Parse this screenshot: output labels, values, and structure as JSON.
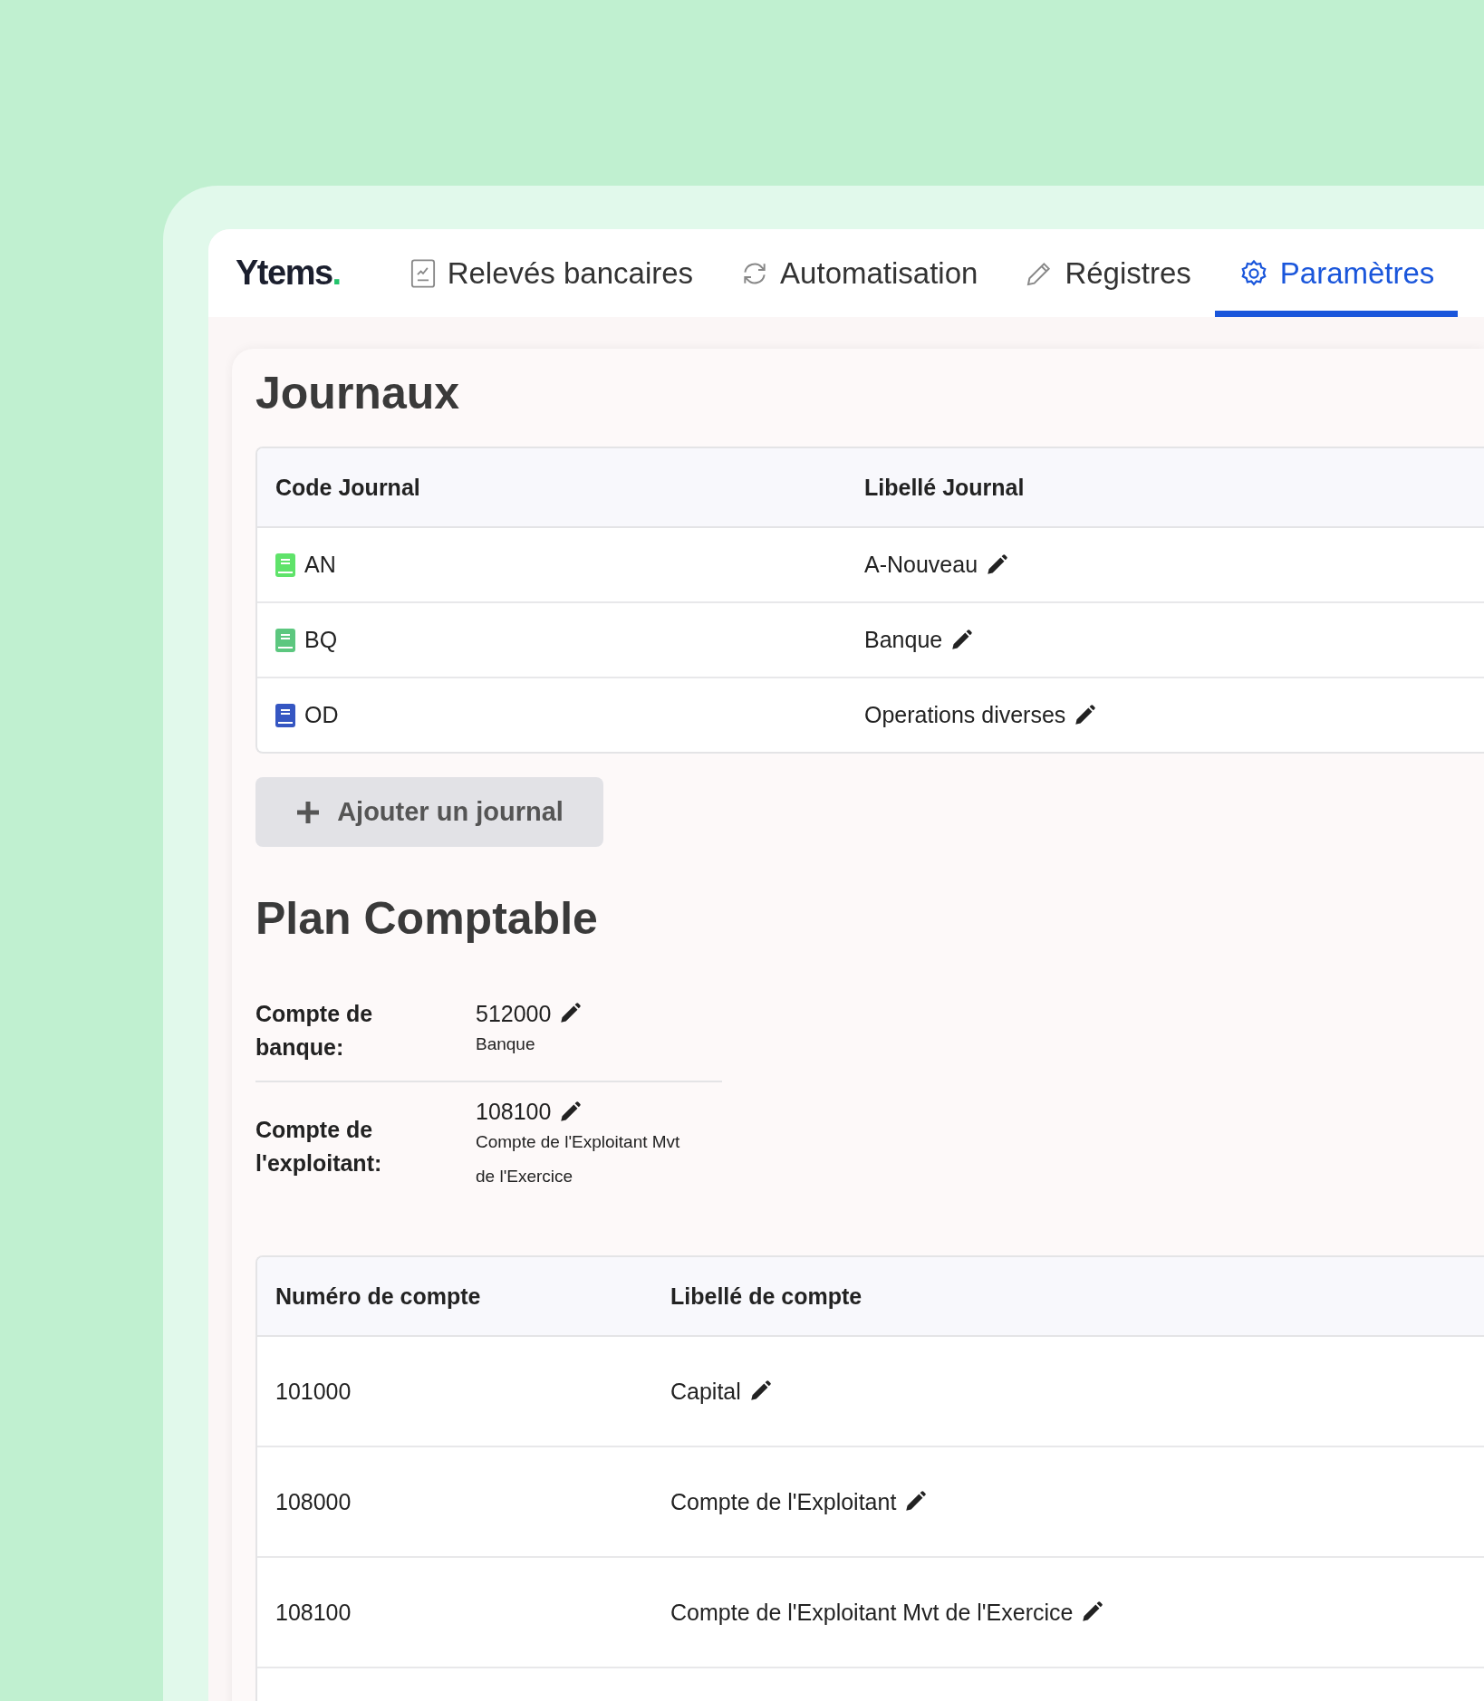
{
  "logo": {
    "text": "Ytems",
    "dot": "."
  },
  "tabs": [
    {
      "label": "Relevés bancaires",
      "kind": "document",
      "selected": false
    },
    {
      "label": "Automatisation",
      "kind": "refresh",
      "selected": false
    },
    {
      "label": "Régistres",
      "kind": "pencil",
      "selected": false
    },
    {
      "label": "Paramètres",
      "kind": "gear",
      "selected": true
    }
  ],
  "journals": {
    "title": "Journaux",
    "columns": [
      "Code Journal",
      "Libellé Journal"
    ],
    "rows": [
      {
        "code": "AN",
        "color": "#5fe36a",
        "label": "A-Nouveau"
      },
      {
        "code": "BQ",
        "color": "#5cc77f",
        "label": "Banque"
      },
      {
        "code": "OD",
        "color": "#3556c2",
        "label": "Operations diverses"
      }
    ],
    "add_button": "Ajouter un journal"
  },
  "plan": {
    "title": "Plan Comptable",
    "fields": [
      {
        "label": "Compte de banque:",
        "number": "512000",
        "description": "Banque"
      },
      {
        "label": "Compte de l'exploitant:",
        "number": "108100",
        "description": "Compte de l'Exploitant Mvt de l'Exercice"
      }
    ],
    "columns": [
      "Numéro de compte",
      "Libellé de compte"
    ],
    "rows": [
      {
        "number": "101000",
        "label": "Capital"
      },
      {
        "number": "108000",
        "label": "Compte de l'Exploitant"
      },
      {
        "number": "108100",
        "label": "Compte de l'Exploitant Mvt de l'Exercice"
      }
    ]
  }
}
